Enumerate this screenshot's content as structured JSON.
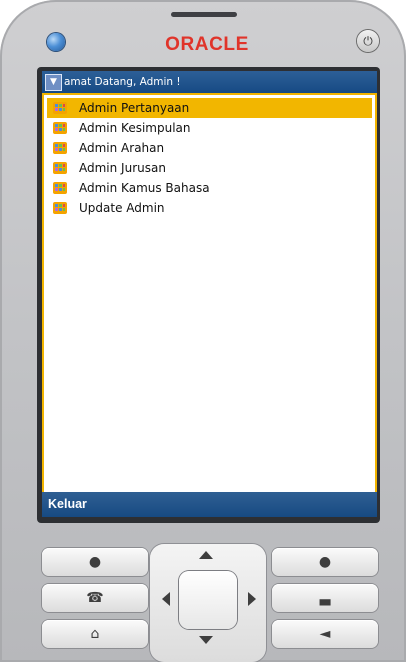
{
  "device": {
    "brand": "ORACLE",
    "power_icon": "power-icon",
    "accent_color": "#e0342a"
  },
  "screen": {
    "title": "amat Datang, Admin !",
    "menu_icon": "chevron-down-icon",
    "items": [
      {
        "label": "Admin Pertanyaan",
        "icon": "app-icon",
        "selected": true
      },
      {
        "label": "Admin Kesimpulan",
        "icon": "app-icon",
        "selected": false
      },
      {
        "label": "Admin Arahan",
        "icon": "app-icon",
        "selected": false
      },
      {
        "label": "Admin Jurusan",
        "icon": "app-icon",
        "selected": false
      },
      {
        "label": "Admin Kamus Bahasa",
        "icon": "app-icon",
        "selected": false
      },
      {
        "label": "Update Admin",
        "icon": "app-icon",
        "selected": false
      }
    ],
    "softkey_left": "Keluar",
    "colors": {
      "titlebar": "#174a82",
      "selection": "#f2b600",
      "list_border": "#f1b400"
    }
  },
  "keypad": {
    "left_soft_key_icon": "dot-icon",
    "right_soft_key_icon": "dot-icon",
    "call_icon": "phone-call-icon",
    "end_call_icon": "phone-end-icon",
    "home_icon": "home-icon",
    "back_icon": "back-icon",
    "dpad_icons": [
      "arrow-up-icon",
      "arrow-down-icon",
      "arrow-left-icon",
      "arrow-right-icon"
    ]
  }
}
